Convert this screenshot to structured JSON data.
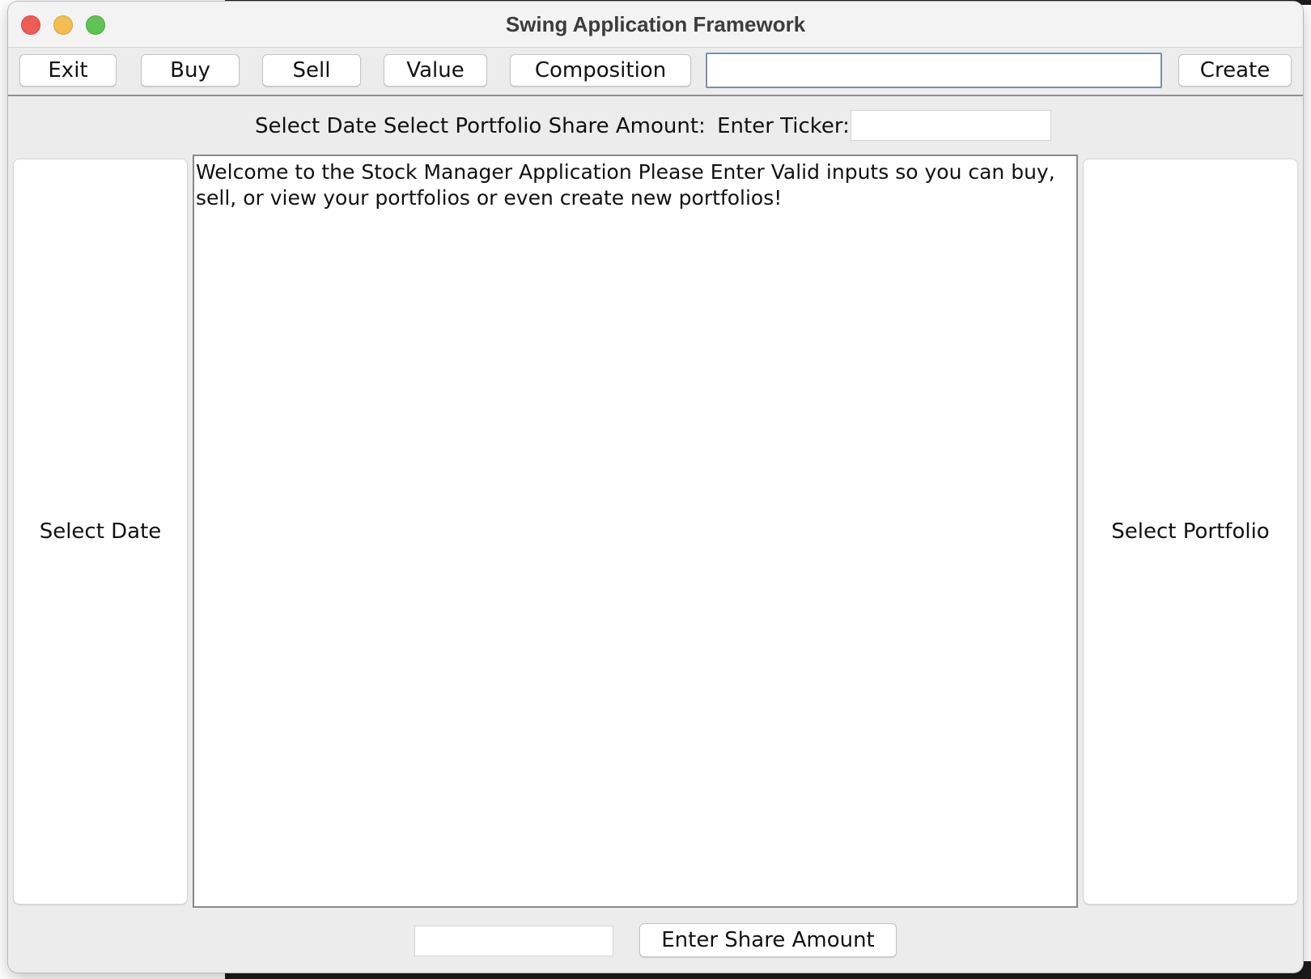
{
  "window": {
    "title": "Swing Application Framework"
  },
  "toolbar": {
    "exit_label": "Exit",
    "buy_label": "Buy",
    "sell_label": "Sell",
    "value_label": "Value",
    "composition_label": "Composition",
    "name_input_value": "",
    "create_label": "Create"
  },
  "header": {
    "select_date_label": "Select Date",
    "select_portfolio_label": "Select Portfolio",
    "share_amount_label": "Share Amount:",
    "enter_ticker_label": "Enter Ticker:",
    "ticker_input_value": ""
  },
  "main": {
    "select_date_button": "Select Date",
    "select_portfolio_button": "Select Portfolio",
    "output_text": "Welcome to the Stock Manager Application Please Enter Valid inputs so you can buy, sell, or view your portfolios or even create new portfolios!"
  },
  "footer": {
    "share_amount_input_value": "",
    "enter_share_amount_label": "Enter Share Amount"
  },
  "colors": {
    "window_bg": "#ececec",
    "close": "#ee5c54",
    "minimize": "#f5bd4f",
    "maximize": "#5fc453",
    "focus_ring": "#7d8ea8"
  }
}
